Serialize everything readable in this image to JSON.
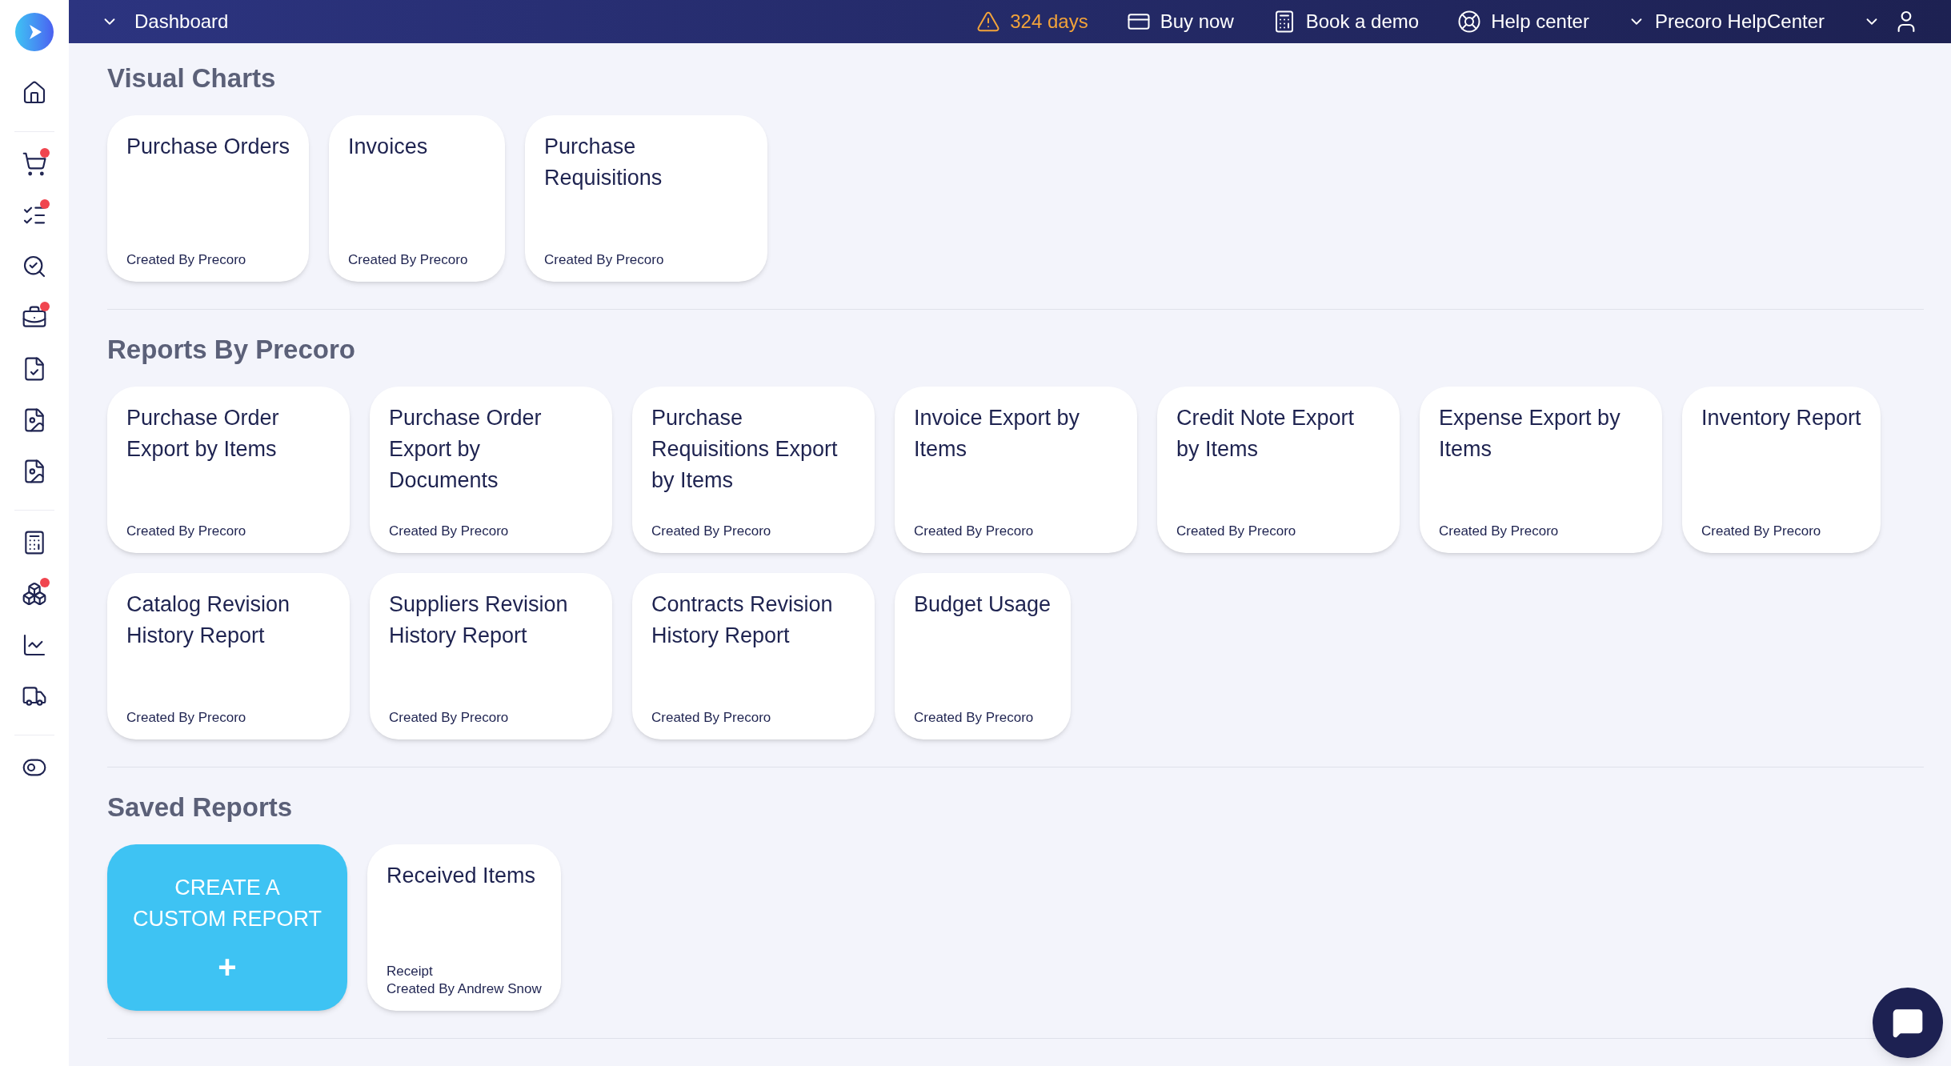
{
  "sidebar": {
    "items": [
      {
        "badge": false
      },
      {
        "badge": true
      },
      {
        "badge": true
      },
      {
        "badge": false
      },
      {
        "badge": true
      },
      {
        "badge": false
      },
      {
        "badge": false
      },
      {
        "badge": false
      },
      {
        "badge": false
      },
      {
        "badge": true
      },
      {
        "badge": false
      },
      {
        "badge": false
      },
      {
        "badge": false
      }
    ]
  },
  "top_bar": {
    "title": "Dashboard",
    "warning": "324 days",
    "links": [
      "Buy now",
      "Book a demo",
      "Help center"
    ],
    "company": "Precoro HelpCenter"
  },
  "sections": [
    {
      "title": "Visual Charts",
      "cards": [
        {
          "kind": "report",
          "title": "Purchase Orders",
          "lines": [
            "Created By Precoro"
          ]
        },
        {
          "kind": "report",
          "title": "Invoices",
          "lines": [
            "Created By Precoro"
          ]
        },
        {
          "kind": "report",
          "title": "Purchase Requisitions",
          "lines": [
            "Created By Precoro"
          ]
        }
      ]
    },
    {
      "title": "Reports By Precoro",
      "cards": [
        {
          "kind": "report",
          "title": "Purchase Order Export by Items",
          "lines": [
            "Created By Precoro"
          ]
        },
        {
          "kind": "report",
          "title": "Purchase Order Export by Documents",
          "lines": [
            "Created By Precoro"
          ]
        },
        {
          "kind": "report",
          "title": "Purchase Requisitions Export by Items",
          "lines": [
            "Created By Precoro"
          ]
        },
        {
          "kind": "report",
          "title": "Invoice Export by Items",
          "lines": [
            "Created By Precoro"
          ]
        },
        {
          "kind": "report",
          "title": "Credit Note Export by Items",
          "lines": [
            "Created By Precoro"
          ]
        },
        {
          "kind": "report",
          "title": "Expense Export by Items",
          "lines": [
            "Created By Precoro"
          ]
        },
        {
          "kind": "report",
          "title": "Inventory Report",
          "lines": [
            "Created By Precoro"
          ]
        },
        {
          "kind": "report",
          "title": "Catalog Revision History Report",
          "lines": [
            "Created By Precoro"
          ]
        },
        {
          "kind": "report",
          "title": "Suppliers Revision History Report",
          "lines": [
            "Created By Precoro"
          ]
        },
        {
          "kind": "report",
          "title": "Contracts Revision History Report",
          "lines": [
            "Created By Precoro"
          ]
        },
        {
          "kind": "report",
          "title": "Budget Usage",
          "lines": [
            "Created By Precoro"
          ]
        }
      ]
    },
    {
      "title": "Saved Reports",
      "cards": [
        {
          "kind": "create",
          "title": "CREATE A CUSTOM REPORT",
          "plus": "+"
        },
        {
          "kind": "report",
          "title": "Received Items",
          "lines": [
            "Receipt",
            "Created By Andrew Snow"
          ]
        }
      ]
    }
  ]
}
